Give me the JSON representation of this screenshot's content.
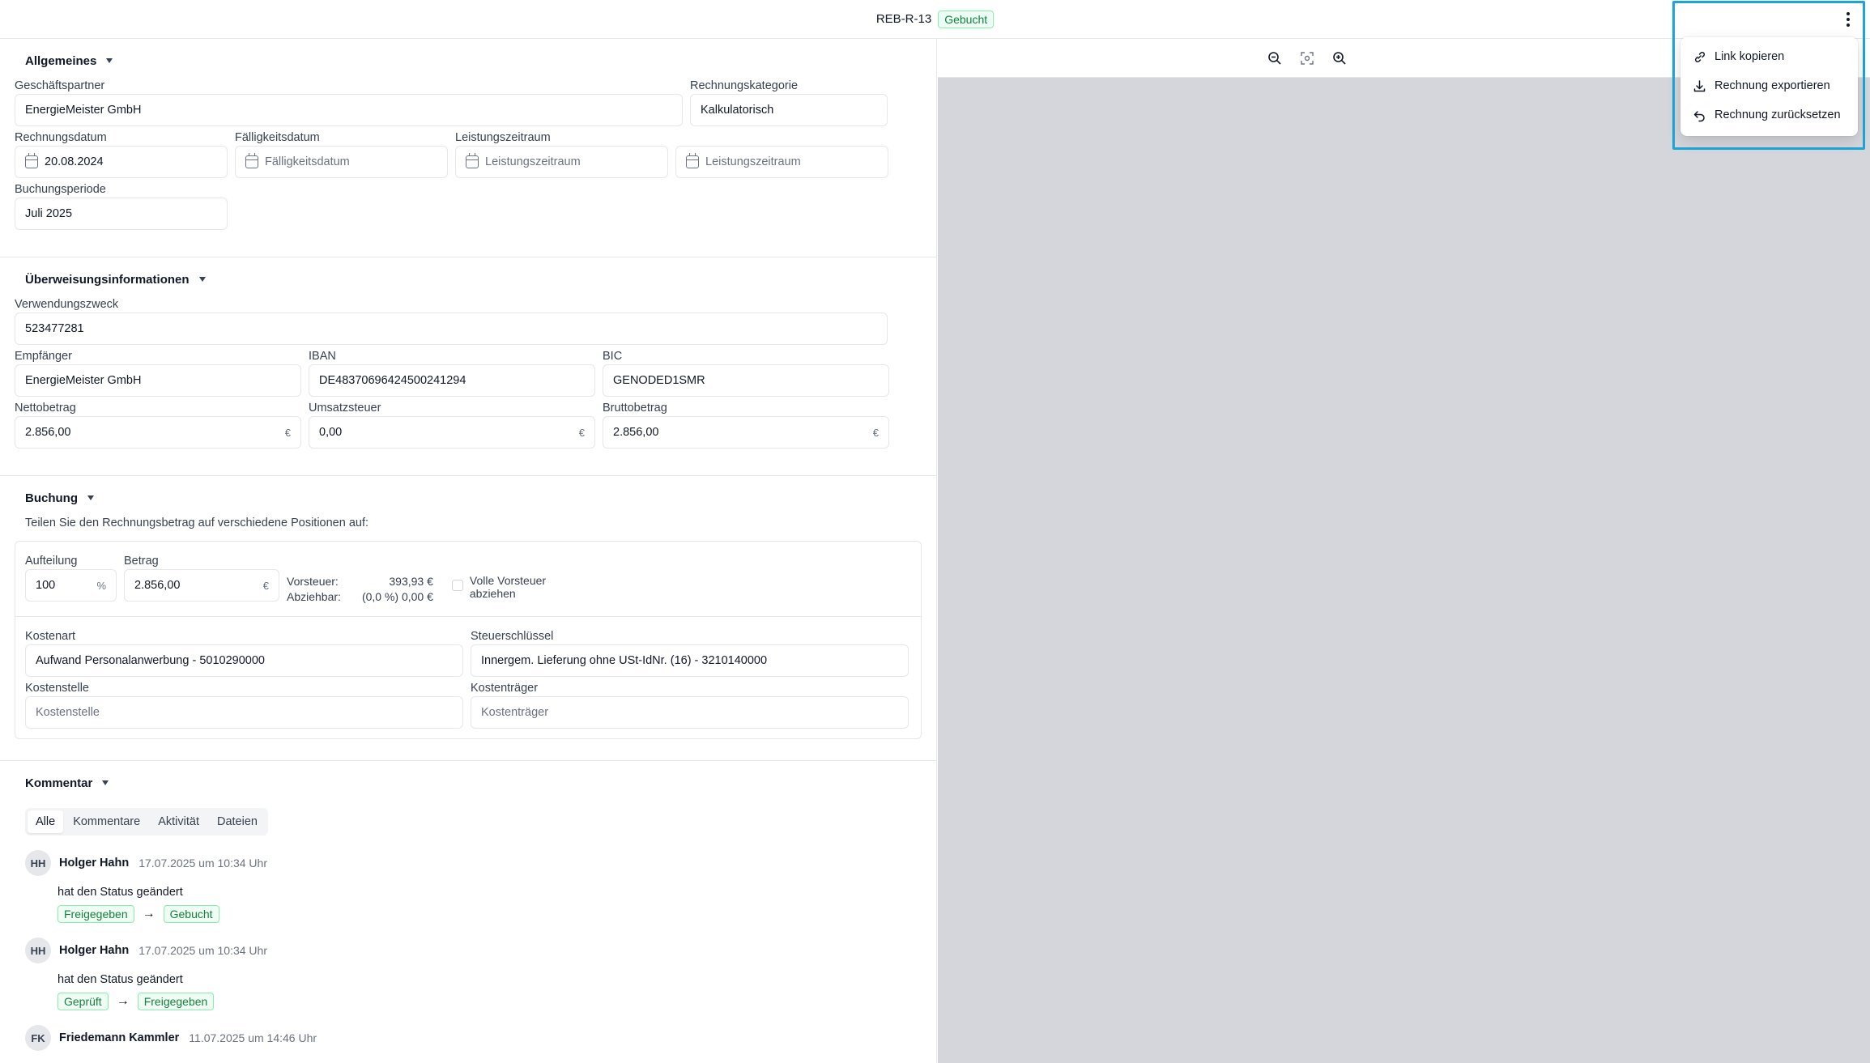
{
  "header": {
    "title": "REB-R-13",
    "status": "Gebucht"
  },
  "menu": {
    "items": [
      {
        "label": "Link kopieren",
        "icon": "link-icon"
      },
      {
        "label": "Rechnung exportieren",
        "icon": "download-icon"
      },
      {
        "label": "Rechnung zurücksetzen",
        "icon": "undo-icon"
      }
    ]
  },
  "allgemeines": {
    "title": "Allgemeines",
    "partner_label": "Geschäftspartner",
    "partner": "EnergieMeister GmbH",
    "kategorie_label": "Rechnungskategorie",
    "kategorie": "Kalkulatorisch",
    "datum_label": "Rechnungsdatum",
    "datum": "20.08.2024",
    "faellig_label": "Fälligkeitsdatum",
    "faellig_ph": "Fälligkeitsdatum",
    "zeitraum_label": "Leistungszeitraum",
    "zeitraum_ph1": "Leistungszeitraum",
    "zeitraum_ph2": "Leistungszeitraum",
    "periode_label": "Buchungsperiode",
    "periode": "Juli 2025"
  },
  "ueberweisung": {
    "title": "Überweisungsinformationen",
    "zweck_label": "Verwendungszweck",
    "zweck": "523477281",
    "empf_label": "Empfänger",
    "empf": "EnergieMeister GmbH",
    "iban_label": "IBAN",
    "iban": "DE48370696424500241294",
    "bic_label": "BIC",
    "bic": "GENODED1SMR",
    "netto_label": "Nettobetrag",
    "netto": "2.856,00",
    "ust_label": "Umsatzsteuer",
    "ust": "0,00",
    "brutto_label": "Bruttobetrag",
    "brutto": "2.856,00",
    "currency": "€"
  },
  "buchung": {
    "title": "Buchung",
    "hint": "Teilen Sie den Rechnungsbetrag auf verschiedene Positionen auf:",
    "aufteilung_label": "Aufteilung",
    "aufteilung": "100",
    "percent": "%",
    "betrag_label": "Betrag",
    "betrag": "2.856,00",
    "vorsteuer_label": "Vorsteuer:",
    "vorsteuer": "393,93 €",
    "abziehbar_label": "Abziehbar:",
    "abziehbar": "(0,0 %) 0,00 €",
    "volle_line1": "Volle Vorsteuer",
    "volle_line2": "abziehen",
    "kostenart_label": "Kostenart",
    "kostenart": "Aufwand Personalanwerbung - 5010290000",
    "steuer_label": "Steuerschlüssel",
    "steuer": "Innergem. Lieferung ohne USt-IdNr. (16) - 3210140000",
    "kostenstelle_label": "Kostenstelle",
    "kostenstelle_ph": "Kostenstelle",
    "kostentraeger_label": "Kostenträger",
    "kostentraeger_ph": "Kostenträger"
  },
  "kommentar": {
    "title": "Kommentar",
    "tabs": [
      "Alle",
      "Kommentare",
      "Aktivität",
      "Dateien"
    ],
    "entries": [
      {
        "initials": "HH",
        "author": "Holger Hahn",
        "date": "17.07.2025 um 10:34 Uhr",
        "text": "hat den Status geändert",
        "from": "Freigegeben",
        "to": "Gebucht"
      },
      {
        "initials": "HH",
        "author": "Holger Hahn",
        "date": "17.07.2025 um 10:34 Uhr",
        "text": "hat den Status geändert",
        "from": "Geprüft",
        "to": "Freigegeben"
      },
      {
        "initials": "FK",
        "author": "Friedemann Kammler",
        "date": "11.07.2025 um 14:46 Uhr"
      }
    ]
  }
}
